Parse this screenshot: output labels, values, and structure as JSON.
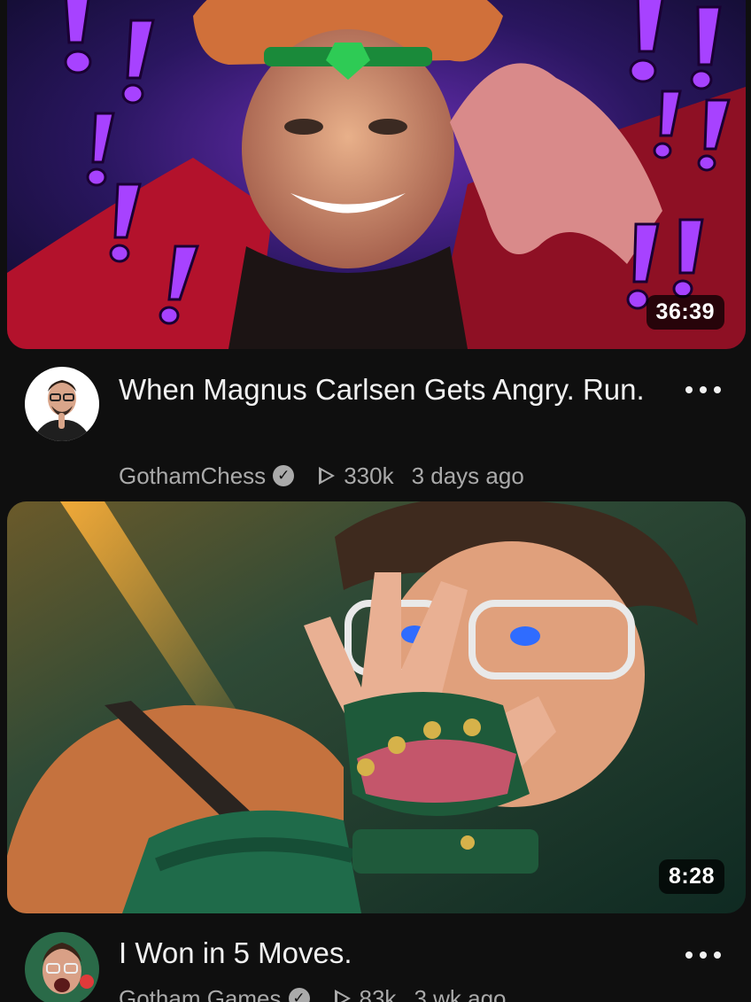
{
  "videos": [
    {
      "duration": "36:39",
      "title": "When Magnus Carlsen Gets Angry. Run.",
      "channel": "GothamChess",
      "views": "330k",
      "age": "3 days ago",
      "avatar_icon": "channel-avatar",
      "verified_icon": "verified-check-icon",
      "menu_icon": "more-options-icon"
    },
    {
      "duration": "8:28",
      "title": "I Won in 5 Moves.",
      "channel": "Gotham Games",
      "views": "83k",
      "age": "3 wk ago",
      "avatar_icon": "channel-avatar",
      "verified_icon": "verified-check-icon",
      "menu_icon": "more-options-icon"
    }
  ],
  "colors": {
    "background": "#0f0f0f",
    "primary_text": "#f1f1f1",
    "secondary_text": "#aaaaaa",
    "thumb1_accent": "#9b3cff",
    "thumb2_accent": "#1f6b4a"
  }
}
